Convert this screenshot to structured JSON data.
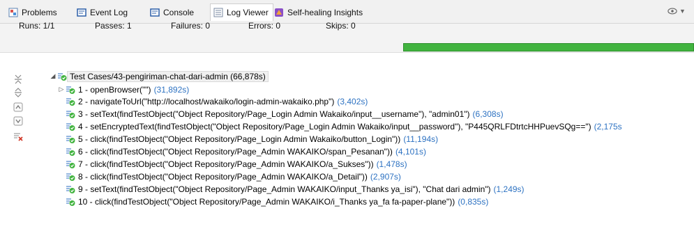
{
  "tabs": [
    {
      "label": "Problems",
      "icon": "problems-icon"
    },
    {
      "label": "Event Log",
      "icon": "event-log-icon"
    },
    {
      "label": "Console",
      "icon": "console-icon"
    },
    {
      "label": "Log Viewer",
      "icon": "log-viewer-icon",
      "active": true
    },
    {
      "label": "Self-healing Insights",
      "icon": "self-healing-icon"
    }
  ],
  "stats": {
    "runs": "Runs: 1/1",
    "passes": "Passes: 1",
    "failures": "Failures: 0",
    "errors": "Errors: 0",
    "skips": "Skips: 0",
    "progress": 1.0
  },
  "root": {
    "label": "Test Cases/43-pengiriman-chat-dari-admin",
    "time": "(66,878s)"
  },
  "steps": [
    {
      "label": "1 - openBrowser(\"\")",
      "time": "(31,892s)",
      "expandable": true
    },
    {
      "label": "2 - navigateToUrl(\"http://localhost/wakaiko/login-admin-wakaiko.php\")",
      "time": "(3,402s)"
    },
    {
      "label": "3 - setText(findTestObject(\"Object Repository/Page_Login Admin Wakaiko/input__username\"), \"admin01\")",
      "time": "(6,308s)"
    },
    {
      "label": "4 - setEncryptedText(findTestObject(\"Object Repository/Page_Login Admin Wakaiko/input__password\"), \"P445QRLFDtrtcHHPuevSQg==\")",
      "time": "(2,175s"
    },
    {
      "label": "5 - click(findTestObject(\"Object Repository/Page_Login Admin Wakaiko/button_Login\"))",
      "time": "(11,194s)"
    },
    {
      "label": "6 - click(findTestObject(\"Object Repository/Page_Admin WAKAIKO/span_Pesanan\"))",
      "time": "(4,101s)"
    },
    {
      "label": "7 - click(findTestObject(\"Object Repository/Page_Admin WAKAIKO/a_Sukses\"))",
      "time": "(1,478s)"
    },
    {
      "label": "8 - click(findTestObject(\"Object Repository/Page_Admin WAKAIKO/a_Detail\"))",
      "time": "(2,907s)"
    },
    {
      "label": "9 - setText(findTestObject(\"Object Repository/Page_Admin WAKAIKO/input_Thanks ya_isi\"), \"Chat dari admin\")",
      "time": "(1,249s)"
    },
    {
      "label": "10 - click(findTestObject(\"Object Repository/Page_Admin WAKAIKO/i_Thanks ya_fa fa-paper-plane\"))",
      "time": "(0,835s)"
    }
  ],
  "colors": {
    "pass": "#41b33f",
    "time": "#2d72c2",
    "fail": "#d23b2b"
  }
}
